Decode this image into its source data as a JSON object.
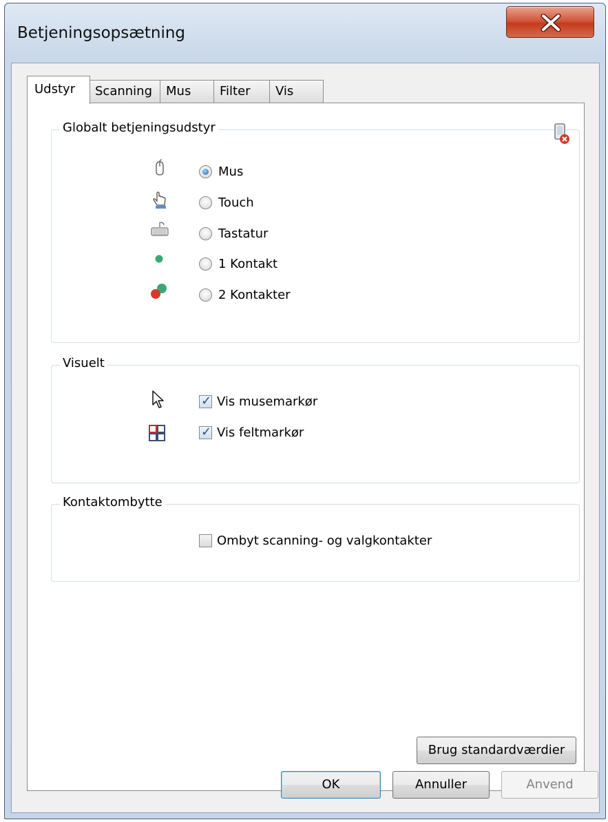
{
  "window": {
    "title": "Betjeningsopsætning"
  },
  "tabs": [
    {
      "label": "Udstyr",
      "active": true
    },
    {
      "label": "Scanning",
      "active": false
    },
    {
      "label": "Mus",
      "active": false
    },
    {
      "label": "Filter",
      "active": false
    },
    {
      "label": "Vis",
      "active": false
    }
  ],
  "equipment_group": {
    "title": "Globalt betjeningsudstyr",
    "options": [
      {
        "label": "Mus",
        "icon": "mouse-icon",
        "checked": true
      },
      {
        "label": "Touch",
        "icon": "touch-hand-icon",
        "checked": false
      },
      {
        "label": "Tastatur",
        "icon": "keyboard-icon",
        "checked": false
      },
      {
        "label": "1 Kontakt",
        "icon": "one-switch-icon",
        "checked": false
      },
      {
        "label": "2 Kontakter",
        "icon": "two-switches-icon",
        "checked": false
      }
    ]
  },
  "visual_group": {
    "title": "Visuelt",
    "options": [
      {
        "label": "Vis musemarkør",
        "icon": "mouse-pointer-icon",
        "checked": true
      },
      {
        "label": "Vis feltmarkør",
        "icon": "field-marker-icon",
        "checked": true
      }
    ]
  },
  "swap_group": {
    "title": "Kontaktombytte",
    "option": {
      "label": "Ombyt scanning- og valgkontakter",
      "checked": false
    }
  },
  "buttons": {
    "defaults": "Brug standardværdier",
    "ok": "OK",
    "cancel": "Annuller",
    "apply": "Anvend"
  },
  "colors": {
    "switch_green": "#3aa876",
    "switch_red": "#d63a2a",
    "close_red": "#c43b1d"
  }
}
